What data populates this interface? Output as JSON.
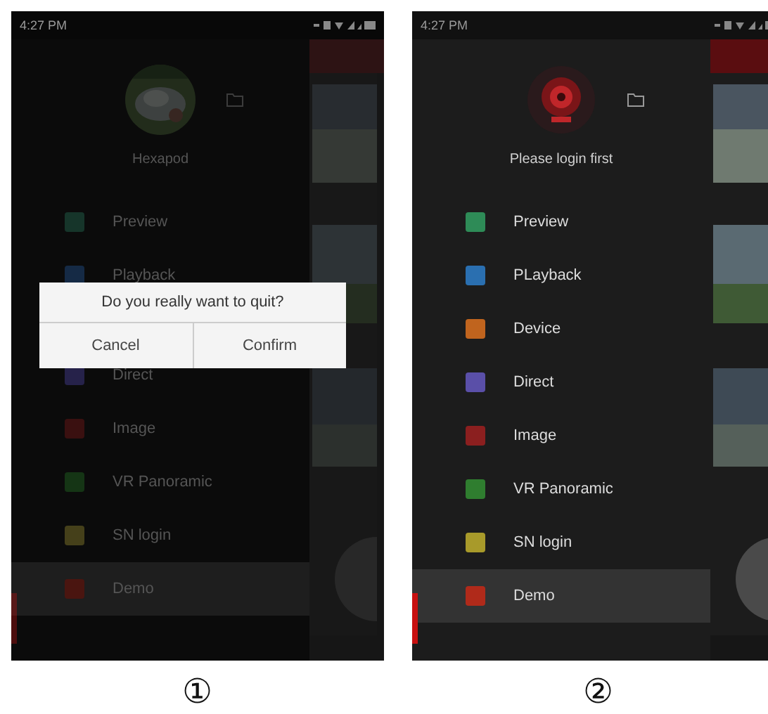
{
  "screens": [
    {
      "caption": "①",
      "status_time": "4:27 PM",
      "dimmed": true,
      "profile": {
        "name": "Hexapod"
      },
      "menu": [
        {
          "kind": "item",
          "label": "Preview",
          "color": "#16352a",
          "selected": false
        },
        {
          "kind": "item",
          "label": "Playback",
          "color": "#152a45",
          "selected": false
        },
        {
          "kind": "dialog",
          "message": "Do you really want to quit?",
          "buttons": [
            "Cancel",
            "Confirm"
          ]
        },
        {
          "kind": "item",
          "label": "Direct",
          "color": "#26224a",
          "selected": false
        },
        {
          "kind": "item",
          "label": "Image",
          "color": "#3a1010",
          "selected": false
        },
        {
          "kind": "item",
          "label": "VR Panoramic",
          "color": "#153515",
          "selected": false
        },
        {
          "kind": "item",
          "label": "SN login",
          "color": "#45401a",
          "selected": false
        },
        {
          "kind": "item",
          "label": "Demo",
          "color": "#4a1510",
          "selected": true
        }
      ]
    },
    {
      "caption": "②",
      "status_time": "4:27 PM",
      "dimmed": false,
      "profile": {
        "name": "Please login first",
        "avatar": {
          "kind": "camera"
        }
      },
      "menu": [
        {
          "kind": "item",
          "label": "Preview",
          "color": "#2e8b57",
          "selected": false
        },
        {
          "kind": "item",
          "label": "PLayback",
          "color": "#2a6fb0",
          "selected": false
        },
        {
          "kind": "item",
          "label": "Device",
          "color": "#c0641e",
          "selected": false
        },
        {
          "kind": "item",
          "label": "Direct",
          "color": "#5a4fa8",
          "selected": false
        },
        {
          "kind": "item",
          "label": "Image",
          "color": "#8b1f1f",
          "selected": false
        },
        {
          "kind": "item",
          "label": "VR Panoramic",
          "color": "#2f7d2f",
          "selected": false
        },
        {
          "kind": "item",
          "label": "SN login",
          "color": "#a89a2a",
          "selected": false
        },
        {
          "kind": "item",
          "label": "Demo",
          "color": "#b02a1a",
          "selected": true
        }
      ]
    }
  ]
}
